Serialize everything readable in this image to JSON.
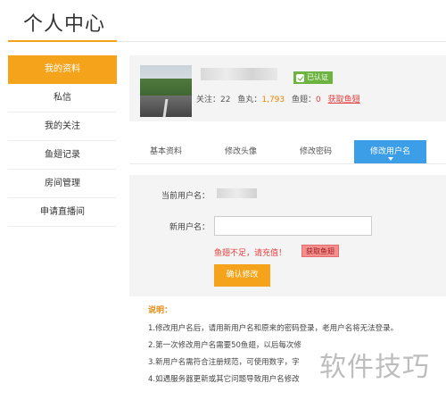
{
  "page": {
    "title": "个人中心"
  },
  "sidebar": {
    "items": [
      {
        "label": "我的资料"
      },
      {
        "label": "私信"
      },
      {
        "label": "我的关注"
      },
      {
        "label": "鱼翅记录"
      },
      {
        "label": "房间管理"
      },
      {
        "label": "申请直播间"
      }
    ]
  },
  "profile": {
    "verified_label": "已认证",
    "follow_label": "关注：",
    "follow_count": "22",
    "fishball_label": "鱼丸：",
    "fishball_count": "1,793",
    "fishfin_label": "鱼翅：",
    "fishfin_count": "0",
    "get_fishfin_link": "获取鱼翅"
  },
  "tabs": [
    {
      "label": "基本资料"
    },
    {
      "label": "修改头像"
    },
    {
      "label": "修改密码"
    },
    {
      "label": "修改用户名"
    }
  ],
  "form": {
    "current_label": "当前用户名：",
    "new_label": "新用户名：",
    "new_value": "",
    "warning": "鱼翅不足，请充值！",
    "get_button": "获取鱼翅",
    "confirm_button": "确认修改"
  },
  "notes": {
    "title": "说明：",
    "lines": [
      "1.修改用户名后，请用新用户名和原来的密码登录，老用户名将无法登录。",
      "2.第一次修改用户名需要50鱼翅，以后每次修",
      "3.新用户名需符合注册规范，可使用数字，字",
      "4.如遇服务器更新或其它问题导致用户名修改"
    ]
  },
  "watermark": {
    "text": "软件技巧"
  },
  "colors": {
    "accent": "#f5a31a",
    "tab_active": "#3d9ee8",
    "verified": "#6cb33f",
    "warning": "#e73c3c"
  }
}
